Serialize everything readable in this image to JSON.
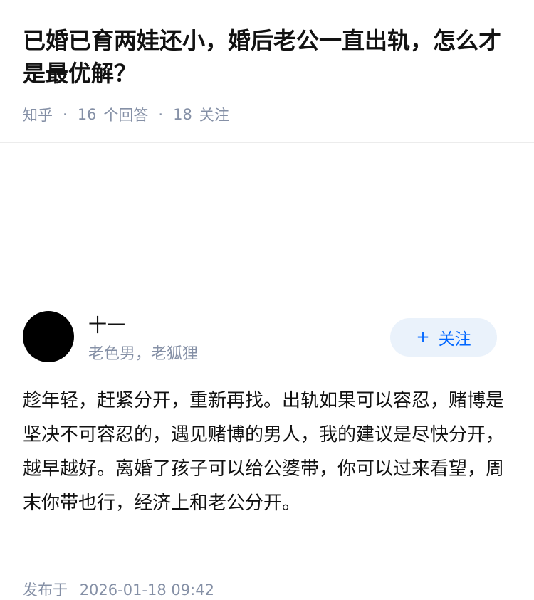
{
  "question": {
    "title": "已婚已育两娃还小，婚后老公一直出轨，怎么才是最优解？",
    "source": "知乎",
    "separator": "·",
    "answer_count": "16",
    "answer_label": "个回答",
    "follower_count": "18",
    "follower_label": "关注"
  },
  "answer": {
    "author_name": "十一",
    "author_bio": "老色男，老狐狸",
    "follow_plus": "+",
    "follow_label": "关注",
    "content": "趁年轻，赶紧分开，重新再找。出轨如果可以容忍，赌博是坚决不可容忍的，遇见赌博的男人，我的建议是尽快分开，越早越好。离婚了孩子可以给公婆带，你可以过来看望，周末你带也行，经济上和老公分开。",
    "published_label": "发布于",
    "published_time": "2026-01-18 09:42"
  }
}
